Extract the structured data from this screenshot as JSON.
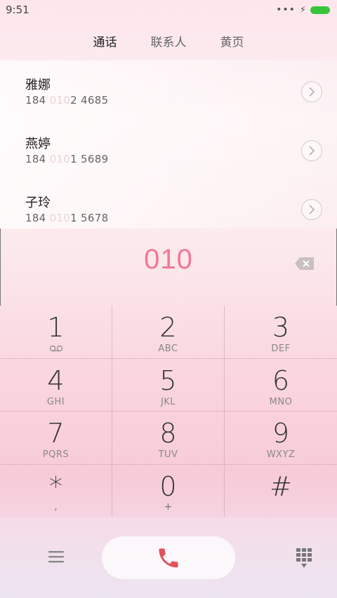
{
  "status_bar": {
    "time": "9:51",
    "dots": "•••",
    "bolt": "⚡"
  },
  "tabs": [
    {
      "label": "通话",
      "active": true
    },
    {
      "label": "联系人",
      "active": false
    },
    {
      "label": "黄页",
      "active": false
    }
  ],
  "contacts": [
    {
      "name": "雅娜",
      "phone_prefix": "184",
      "phone_mid": "010",
      "phone_suffix": "2 4685"
    },
    {
      "name": "燕婷",
      "phone_prefix": "184",
      "phone_mid": "010",
      "phone_suffix": "1 5689"
    },
    {
      "name": "子玲",
      "phone_prefix": "184",
      "phone_mid": "010",
      "phone_suffix": "1 5678"
    }
  ],
  "dial_input": {
    "value": "010"
  },
  "keypad": [
    {
      "digit": "1",
      "letters": ""
    },
    {
      "digit": "2",
      "letters": "ABC"
    },
    {
      "digit": "3",
      "letters": "DEF"
    },
    {
      "digit": "4",
      "letters": "GHI"
    },
    {
      "digit": "5",
      "letters": "JKL"
    },
    {
      "digit": "6",
      "letters": "MNO"
    },
    {
      "digit": "7",
      "letters": "PQRS"
    },
    {
      "digit": "8",
      "letters": "TUV"
    },
    {
      "digit": "9",
      "letters": "WXYZ"
    },
    {
      "digit": "*",
      "letters": ","
    },
    {
      "digit": "0",
      "letters": "+"
    },
    {
      "digit": "#",
      "letters": ""
    }
  ],
  "colors": {
    "accent": "#f07898",
    "call_icon": "#e0535a",
    "battery": "#3ac43a"
  }
}
